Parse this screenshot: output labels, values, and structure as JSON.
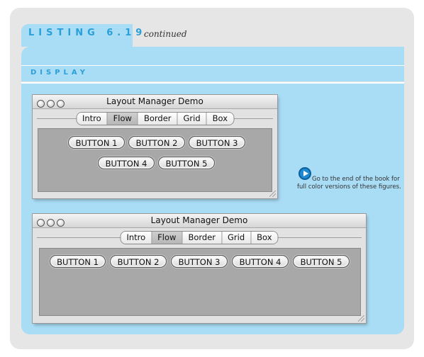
{
  "header": {
    "listing_label": "LISTING 6.19",
    "continued": "continued",
    "display_label": "DISPLAY"
  },
  "windows": [
    {
      "title": "Layout Manager Demo",
      "tabs": [
        "Intro",
        "Flow",
        "Border",
        "Grid",
        "Box"
      ],
      "active_tab": "Flow",
      "buttons": [
        "BUTTON 1",
        "BUTTON 2",
        "BUTTON 3",
        "BUTTON 4",
        "BUTTON 5"
      ]
    },
    {
      "title": "Layout Manager Demo",
      "tabs": [
        "Intro",
        "Flow",
        "Border",
        "Grid",
        "Box"
      ],
      "active_tab": "Flow",
      "buttons": [
        "BUTTON 1",
        "BUTTON 2",
        "BUTTON 3",
        "BUTTON 4",
        "BUTTON 5"
      ]
    }
  ],
  "note": {
    "icon": "play-circle-icon",
    "text": "Go to the end of the book for full color versions of these figures."
  },
  "colors": {
    "accent": "#2a9fd8",
    "panel": "#a9dcf5",
    "frame": "#e6e6e6"
  }
}
